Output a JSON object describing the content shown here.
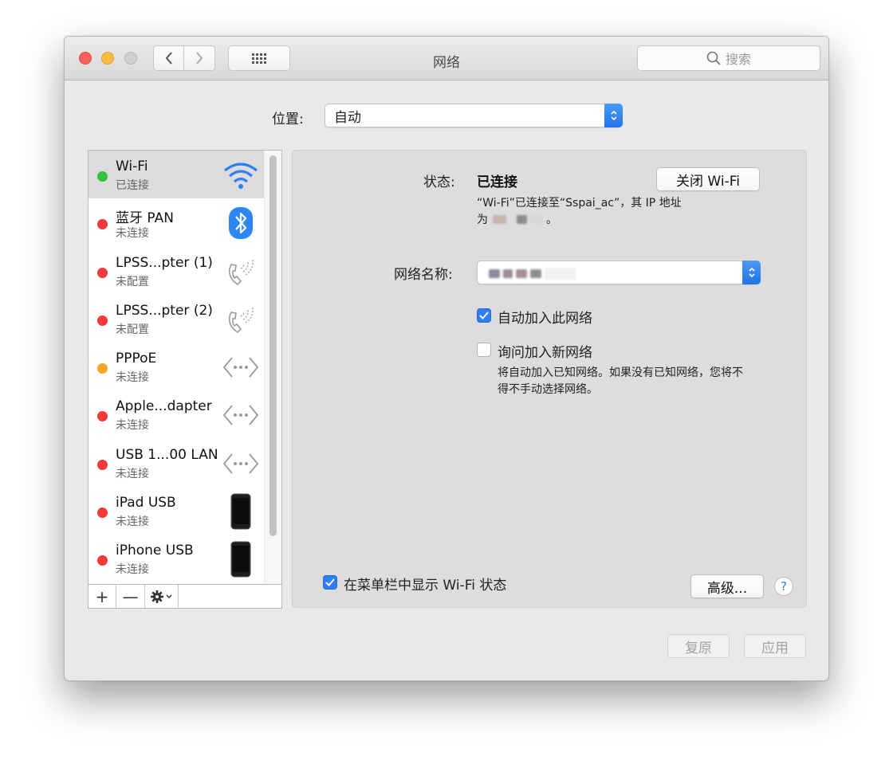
{
  "window": {
    "title": "网络",
    "search_placeholder": "搜索"
  },
  "location": {
    "label": "位置:",
    "value": "自动"
  },
  "services": [
    {
      "name": "Wi-Fi",
      "status": "已连接",
      "status_color": "#35c13f",
      "icon": "wifi-icon",
      "selected": true
    },
    {
      "name": "蓝牙 PAN",
      "status": "未连接",
      "status_color": "#f23a3a",
      "icon": "bluetooth-icon"
    },
    {
      "name": "LPSS...pter (1)",
      "status": "未配置",
      "status_color": "#f23a3a",
      "icon": "phone-icon"
    },
    {
      "name": "LPSS...pter (2)",
      "status": "未配置",
      "status_color": "#f23a3a",
      "icon": "phone-icon"
    },
    {
      "name": "PPPoE",
      "status": "未连接",
      "status_color": "#f5a623",
      "icon": "ethernet-icon"
    },
    {
      "name": "Apple...dapter",
      "status": "未连接",
      "status_color": "#f23a3a",
      "icon": "ethernet-icon"
    },
    {
      "name": "USB 1...00 LAN",
      "status": "未连接",
      "status_color": "#f23a3a",
      "icon": "ethernet-icon"
    },
    {
      "name": "iPad USB",
      "status": "未连接",
      "status_color": "#f23a3a",
      "icon": "iphone-icon"
    },
    {
      "name": "iPhone USB",
      "status": "未连接",
      "status_color": "#f23a3a",
      "icon": "iphone-icon"
    }
  ],
  "sidebar_toolbar": {
    "add": "+",
    "remove": "—"
  },
  "detail": {
    "status_label": "状态:",
    "status_value": "已连接",
    "wifi_off_button": "关闭 Wi-Fi",
    "desc_line1": "“Wi-Fi”已连接至“Sspai_ac”，其 IP 地址",
    "desc_line2_prefix": "为",
    "desc_line2_suffix": "。",
    "network_name_label": "网络名称:",
    "auto_join_label": "自动加入此网络",
    "auto_join_checked": true,
    "ask_join_label": "询问加入新网络",
    "ask_join_checked": false,
    "ask_join_help_line1": "将自动加入已知网络。如果没有已知网络，您将不",
    "ask_join_help_line2": "得不手动选择网络。",
    "show_menubar_label": "在菜单栏中显示 Wi-Fi 状态",
    "show_menubar_checked": true,
    "advanced_button": "高级...",
    "help_button": "?"
  },
  "footer": {
    "revert": "复原",
    "apply": "应用"
  },
  "colors": {
    "accent": "#2d7ff3",
    "connected": "#35c13f",
    "disconnected": "#f23a3a",
    "pppoe": "#f5a623"
  }
}
